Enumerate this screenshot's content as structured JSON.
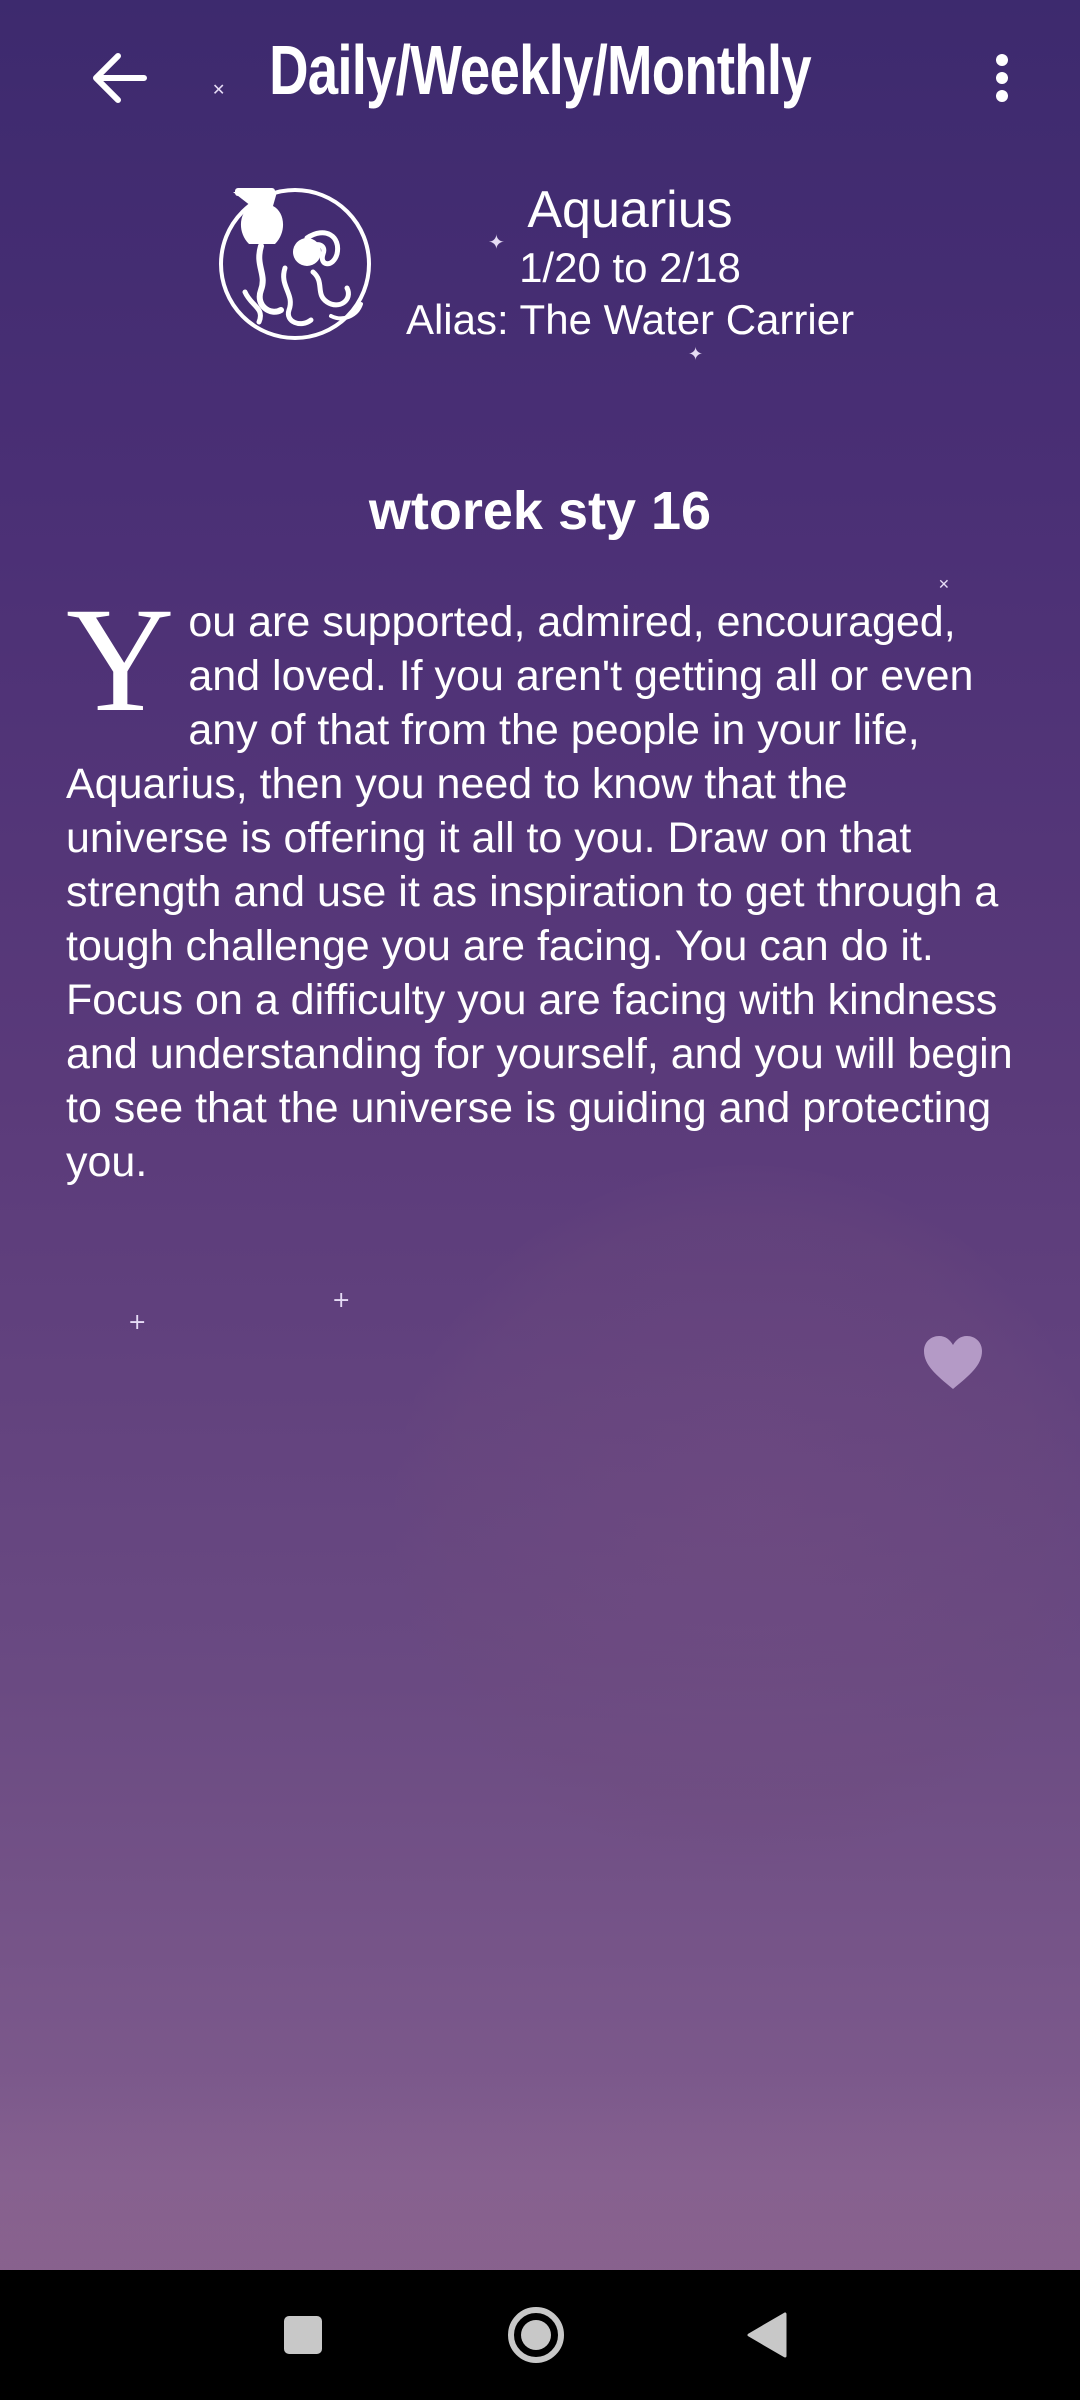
{
  "app_bar": {
    "title": "Daily/Weekly/Monthly",
    "back_icon": "arrow-left-icon",
    "menu_icon": "more-vert-icon"
  },
  "sign": {
    "name": "Aquarius",
    "dates": "1/20 to 2/18",
    "alias": "Alias: The Water Carrier",
    "emblem_icon": "aquarius-water-carrier-icon"
  },
  "reading": {
    "date": "wtorek sty 16",
    "drop_cap": "Y",
    "text": "ou are supported, admired, encouraged, and loved. If you aren't getting all or even any of that from the people in your life, Aquarius, then you need to know that the universe is offering it all to you. Draw on that strength and use it as inspiration to get through a tough challenge you are facing. You can do it. Focus on a difficulty you are facing with kindness and understanding for yourself, and you will begin to see that the universe is guiding and protecting you."
  },
  "favorite": {
    "icon": "heart-icon"
  },
  "nav_bar": {
    "recents_icon": "square-icon",
    "home_icon": "circle-home-icon",
    "back_icon": "triangle-back-icon"
  },
  "colors": {
    "background_top": "#3d2a6e",
    "background_bottom": "#86608e",
    "text": "#ffffff",
    "navbar": "#000000"
  }
}
